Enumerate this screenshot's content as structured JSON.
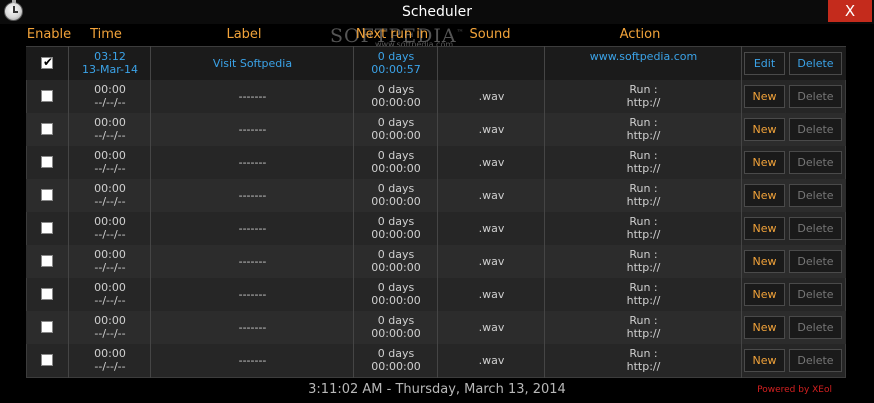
{
  "window": {
    "title": "Scheduler",
    "close_glyph": "X"
  },
  "watermark": {
    "text": "SOFTPEDIA",
    "tm": "™",
    "sub": "www.softpedia.com"
  },
  "columns": {
    "enable": "Enable",
    "time": "Time",
    "label": "Label",
    "next_run": "Next run in",
    "sound": "Sound",
    "action": "Action"
  },
  "rows": [
    {
      "enabled": true,
      "time": "03:12",
      "date": "13-Mar-14",
      "label": "Visit Softpedia",
      "next_days": "0 days",
      "next_time": "00:00:57",
      "sound": "",
      "action_line1": "",
      "action_line2": "www.softpedia.com",
      "primary_button": "Edit",
      "delete_button": "Delete",
      "configured": true
    },
    {
      "enabled": false,
      "time": "00:00",
      "date": "--/--/--",
      "label": "-------",
      "next_days": "0 days",
      "next_time": "00:00:00",
      "sound": ".wav",
      "action_line1": "Run :",
      "action_line2": "http://",
      "primary_button": "New",
      "delete_button": "Delete",
      "configured": false
    },
    {
      "enabled": false,
      "time": "00:00",
      "date": "--/--/--",
      "label": "-------",
      "next_days": "0 days",
      "next_time": "00:00:00",
      "sound": ".wav",
      "action_line1": "Run :",
      "action_line2": "http://",
      "primary_button": "New",
      "delete_button": "Delete",
      "configured": false
    },
    {
      "enabled": false,
      "time": "00:00",
      "date": "--/--/--",
      "label": "-------",
      "next_days": "0 days",
      "next_time": "00:00:00",
      "sound": ".wav",
      "action_line1": "Run :",
      "action_line2": "http://",
      "primary_button": "New",
      "delete_button": "Delete",
      "configured": false
    },
    {
      "enabled": false,
      "time": "00:00",
      "date": "--/--/--",
      "label": "-------",
      "next_days": "0 days",
      "next_time": "00:00:00",
      "sound": ".wav",
      "action_line1": "Run :",
      "action_line2": "http://",
      "primary_button": "New",
      "delete_button": "Delete",
      "configured": false
    },
    {
      "enabled": false,
      "time": "00:00",
      "date": "--/--/--",
      "label": "-------",
      "next_days": "0 days",
      "next_time": "00:00:00",
      "sound": ".wav",
      "action_line1": "Run :",
      "action_line2": "http://",
      "primary_button": "New",
      "delete_button": "Delete",
      "configured": false
    },
    {
      "enabled": false,
      "time": "00:00",
      "date": "--/--/--",
      "label": "-------",
      "next_days": "0 days",
      "next_time": "00:00:00",
      "sound": ".wav",
      "action_line1": "Run :",
      "action_line2": "http://",
      "primary_button": "New",
      "delete_button": "Delete",
      "configured": false
    },
    {
      "enabled": false,
      "time": "00:00",
      "date": "--/--/--",
      "label": "-------",
      "next_days": "0 days",
      "next_time": "00:00:00",
      "sound": ".wav",
      "action_line1": "Run :",
      "action_line2": "http://",
      "primary_button": "New",
      "delete_button": "Delete",
      "configured": false
    },
    {
      "enabled": false,
      "time": "00:00",
      "date": "--/--/--",
      "label": "-------",
      "next_days": "0 days",
      "next_time": "00:00:00",
      "sound": ".wav",
      "action_line1": "Run :",
      "action_line2": "http://",
      "primary_button": "New",
      "delete_button": "Delete",
      "configured": false
    },
    {
      "enabled": false,
      "time": "00:00",
      "date": "--/--/--",
      "label": "-------",
      "next_days": "0 days",
      "next_time": "00:00:00",
      "sound": ".wav",
      "action_line1": "Run :",
      "action_line2": "http://",
      "primary_button": "New",
      "delete_button": "Delete",
      "configured": false
    }
  ],
  "footer": {
    "clock": "3:11:02 AM  -  Thursday, March 13, 2014",
    "powered_by": "Powered by XEol"
  },
  "icons": {
    "app": "stopwatch-icon",
    "close": "close-icon",
    "check": "checkmark-icon"
  },
  "colors": {
    "header": "#f2a33a",
    "link": "#3ba3e8",
    "close": "#c42b1c",
    "powered": "#d42020"
  }
}
